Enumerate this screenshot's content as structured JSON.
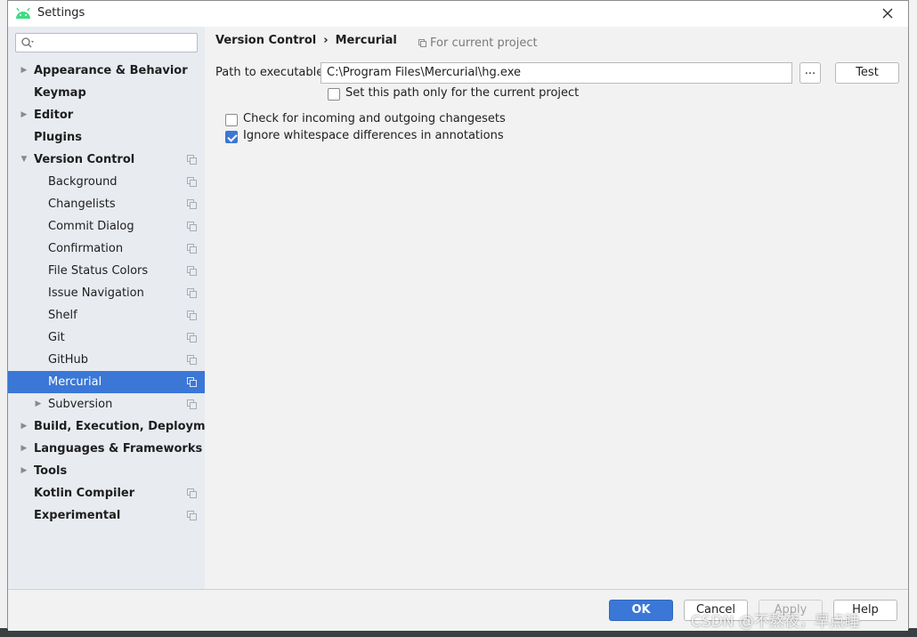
{
  "window": {
    "title": "Settings"
  },
  "search": {
    "placeholder": ""
  },
  "sidebar": {
    "items": [
      {
        "label": "Appearance & Behavior",
        "level": 0,
        "expandable": true,
        "expanded": false,
        "scoped": false
      },
      {
        "label": "Keymap",
        "level": 0,
        "expandable": false,
        "scoped": false
      },
      {
        "label": "Editor",
        "level": 0,
        "expandable": true,
        "expanded": false,
        "scoped": false
      },
      {
        "label": "Plugins",
        "level": 0,
        "expandable": false,
        "scoped": false
      },
      {
        "label": "Version Control",
        "level": 0,
        "expandable": true,
        "expanded": true,
        "scoped": true
      },
      {
        "label": "Background",
        "level": 1,
        "scoped": true
      },
      {
        "label": "Changelists",
        "level": 1,
        "scoped": true
      },
      {
        "label": "Commit Dialog",
        "level": 1,
        "scoped": true
      },
      {
        "label": "Confirmation",
        "level": 1,
        "scoped": true
      },
      {
        "label": "File Status Colors",
        "level": 1,
        "scoped": true
      },
      {
        "label": "Issue Navigation",
        "level": 1,
        "scoped": true
      },
      {
        "label": "Shelf",
        "level": 1,
        "scoped": true
      },
      {
        "label": "Git",
        "level": 1,
        "scoped": true
      },
      {
        "label": "GitHub",
        "level": 1,
        "scoped": true
      },
      {
        "label": "Mercurial",
        "level": 1,
        "scoped": true,
        "selected": true
      },
      {
        "label": "Subversion",
        "level": 1,
        "expandable": true,
        "expanded": false,
        "scoped": true
      },
      {
        "label": "Build, Execution, Deployment",
        "level": 0,
        "expandable": true,
        "expanded": false,
        "scoped": false
      },
      {
        "label": "Languages & Frameworks",
        "level": 0,
        "expandable": true,
        "expanded": false,
        "scoped": false
      },
      {
        "label": "Tools",
        "level": 0,
        "expandable": true,
        "expanded": false,
        "scoped": false
      },
      {
        "label": "Kotlin Compiler",
        "level": 0,
        "expandable": false,
        "scoped": true
      },
      {
        "label": "Experimental",
        "level": 0,
        "expandable": false,
        "scoped": true
      }
    ]
  },
  "main": {
    "breadcrumb": {
      "parent": "Version Control",
      "separator": "›",
      "current": "Mercurial"
    },
    "scope_label": "For current project",
    "path_label": "Path to executable",
    "path_value": "C:\\Program Files\\Mercurial\\hg.exe",
    "browse_label": "...",
    "test_label": "Test",
    "current_project_only": {
      "label": "Set this path only for the current project",
      "checked": false
    },
    "check_incoming": {
      "label": "Check for incoming and outgoing changesets",
      "checked": false
    },
    "ignore_whitespace": {
      "label": "Ignore whitespace differences in annotations",
      "checked": true
    }
  },
  "footer": {
    "ok": "OK",
    "cancel": "Cancel",
    "apply": "Apply",
    "help": "Help"
  },
  "watermark": "CSDN @不熬夜，早点睡",
  "colors": {
    "accent": "#3b77d6",
    "sidebar_bg": "#e8ebf0",
    "dialog_bg": "#f2f2f2",
    "android_green": "#3ddc84"
  }
}
